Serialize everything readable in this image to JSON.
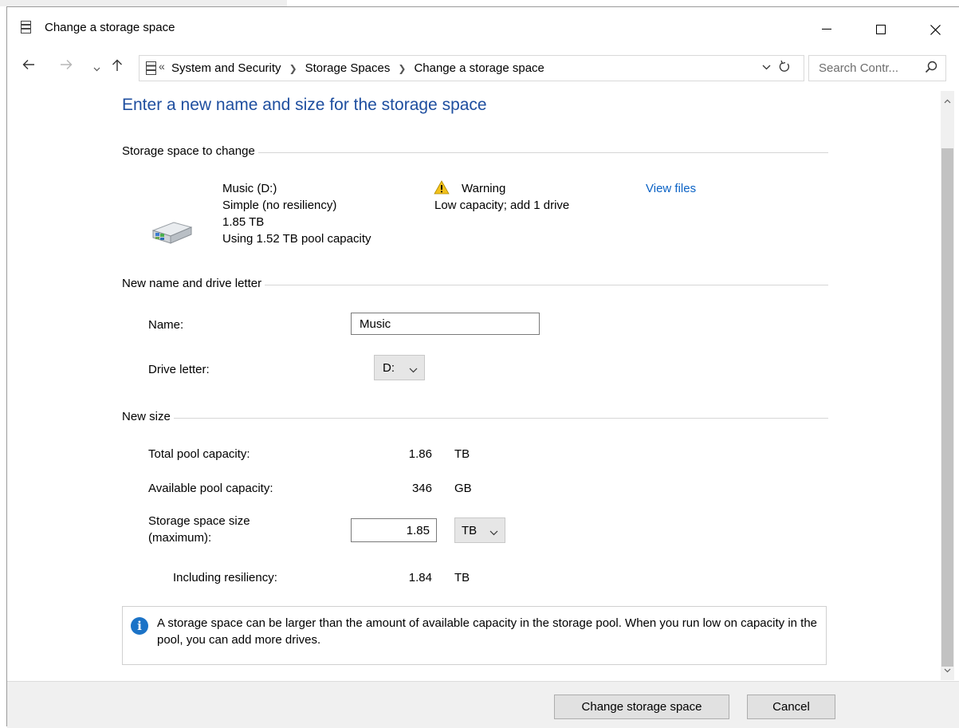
{
  "window": {
    "title": "Change a storage space"
  },
  "address": {
    "crumbs": [
      "System and Security",
      "Storage Spaces",
      "Change a storage space"
    ],
    "overflow": "«"
  },
  "search": {
    "placeholder": "Search Contr..."
  },
  "heading": "Enter a new name and size for the storage space",
  "space_to_change": {
    "section_title": "Storage space to change",
    "name": "Music (D:)",
    "resiliency": "Simple (no resiliency)",
    "size": "1.85 TB",
    "usage": "Using 1.52 TB pool capacity",
    "warning_title": "Warning",
    "warning_detail": "Low capacity; add 1 drive",
    "view_files": "View files"
  },
  "name_letter": {
    "section_title": "New name and drive letter",
    "name_label": "Name:",
    "name_value": "Music",
    "drive_label": "Drive letter:",
    "drive_value": "D:"
  },
  "size": {
    "section_title": "New size",
    "total_label": "Total pool capacity:",
    "total_value": "1.86",
    "total_unit": "TB",
    "avail_label": "Available pool capacity:",
    "avail_value": "346",
    "avail_unit": "GB",
    "size_label_1": "Storage space size",
    "size_label_2": "(maximum):",
    "size_value": "1.85",
    "size_unit": "TB",
    "incl_label": "Including resiliency:",
    "incl_value": "1.84",
    "incl_unit": "TB"
  },
  "info": {
    "icon": "i",
    "message": "A storage space can be larger than the amount of available capacity in the storage pool. When you run low on capacity in the pool, you can add more drives."
  },
  "buttons": {
    "change": "Change storage space",
    "cancel": "Cancel"
  },
  "colors": {
    "heading": "#1e4e9f",
    "link": "#0a62c5",
    "info": "#1b73c7"
  }
}
